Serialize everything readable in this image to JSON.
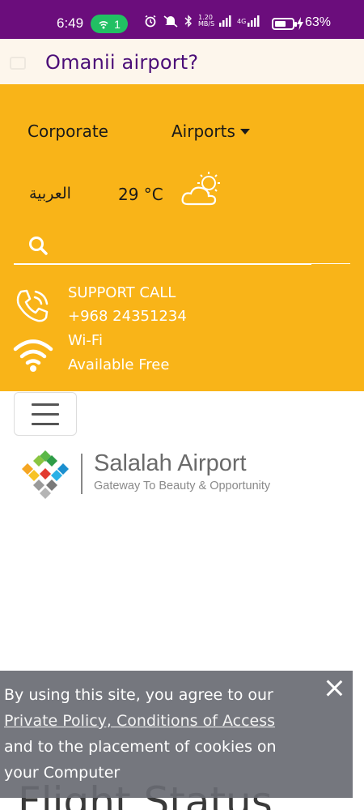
{
  "status_bar": {
    "time": "6:49",
    "hotspot_count": "1",
    "net_speed_value": "1.20",
    "net_speed_unit": "MB/S",
    "network": "4G",
    "battery_level": 0.63,
    "battery_percent": "63%"
  },
  "search_header": {
    "query": "Omanii airport?"
  },
  "nav": {
    "corporate": "Corporate",
    "airports": "Airports"
  },
  "info": {
    "language": "العربية",
    "temperature": "29 °C"
  },
  "search": {
    "placeholder": ""
  },
  "support": {
    "label": "SUPPORT CALL",
    "number": "+968 24351234"
  },
  "wifi": {
    "label": "Wi-Fi",
    "status": "Available Free"
  },
  "logo": {
    "name": "Salalah Airport",
    "tagline": "Gateway To Beauty & Opportunity"
  },
  "page": {
    "heading": "Flight Status"
  },
  "cookie": {
    "text_before": "By using this site, you agree to our",
    "links": "Private Policy, Conditions of Access",
    "text_after": "and to the placement of cookies on your Computer"
  },
  "colors": {
    "status_bar": "#6b0d7c",
    "header_bg": "#fdf6ec",
    "brand_yellow": "#f9b418",
    "query_text": "#4b0e78",
    "cookie_bg": "#696b73",
    "hotspot_green": "#21c063"
  }
}
